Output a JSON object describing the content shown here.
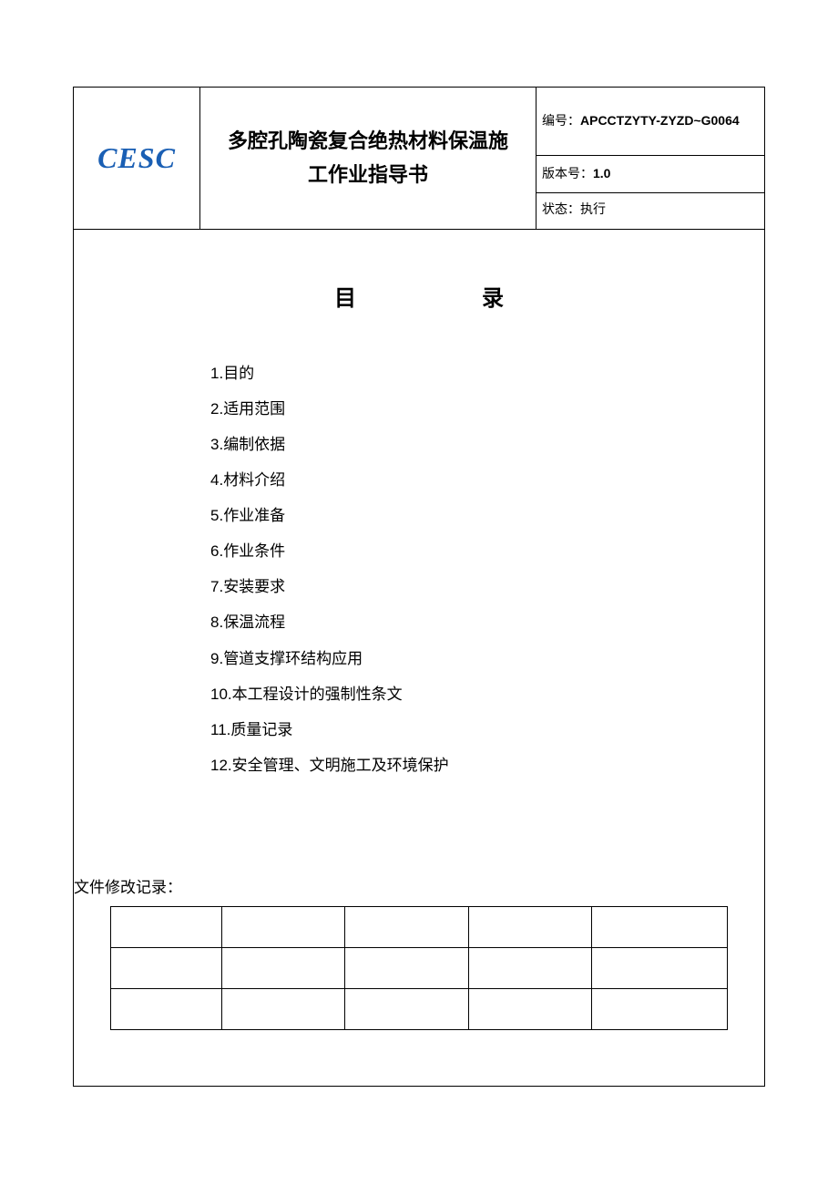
{
  "header": {
    "logo": "CESC",
    "title_line1": "多腔孔陶瓷复合绝热材料保温施",
    "title_line2": "工作业指导书",
    "code_label": "编号：",
    "code_value": "APCCTZYTY-ZYZD~G0064",
    "version_label": "版本号：",
    "version_value": "1.0",
    "status_label": "状态：",
    "status_value": "执行"
  },
  "toc": {
    "heading": "目录",
    "items": [
      {
        "num": "1.",
        "text": "目的"
      },
      {
        "num": "2.",
        "text": "适用范围"
      },
      {
        "num": "3.",
        "text": "编制依据"
      },
      {
        "num": "4.",
        "text": "材料介绍"
      },
      {
        "num": "5.",
        "text": "作业准备"
      },
      {
        "num": "6.",
        "text": "作业条件"
      },
      {
        "num": "7.",
        "text": "安装要求"
      },
      {
        "num": "8.",
        "text": "保温流程"
      },
      {
        "num": "9.",
        "text": "管道支撑环结构应用"
      },
      {
        "num": "10.",
        "text": "本工程设计的强制性条文"
      },
      {
        "num": "11.",
        "text": "质量记录"
      },
      {
        "num": "12.",
        "text": "安全管理、文明施工及环境保护"
      }
    ]
  },
  "revision": {
    "label": "文件修改记录：",
    "rows": [
      [
        "",
        "",
        "",
        "",
        ""
      ],
      [
        "",
        "",
        "",
        "",
        ""
      ],
      [
        "",
        "",
        "",
        "",
        ""
      ]
    ]
  }
}
